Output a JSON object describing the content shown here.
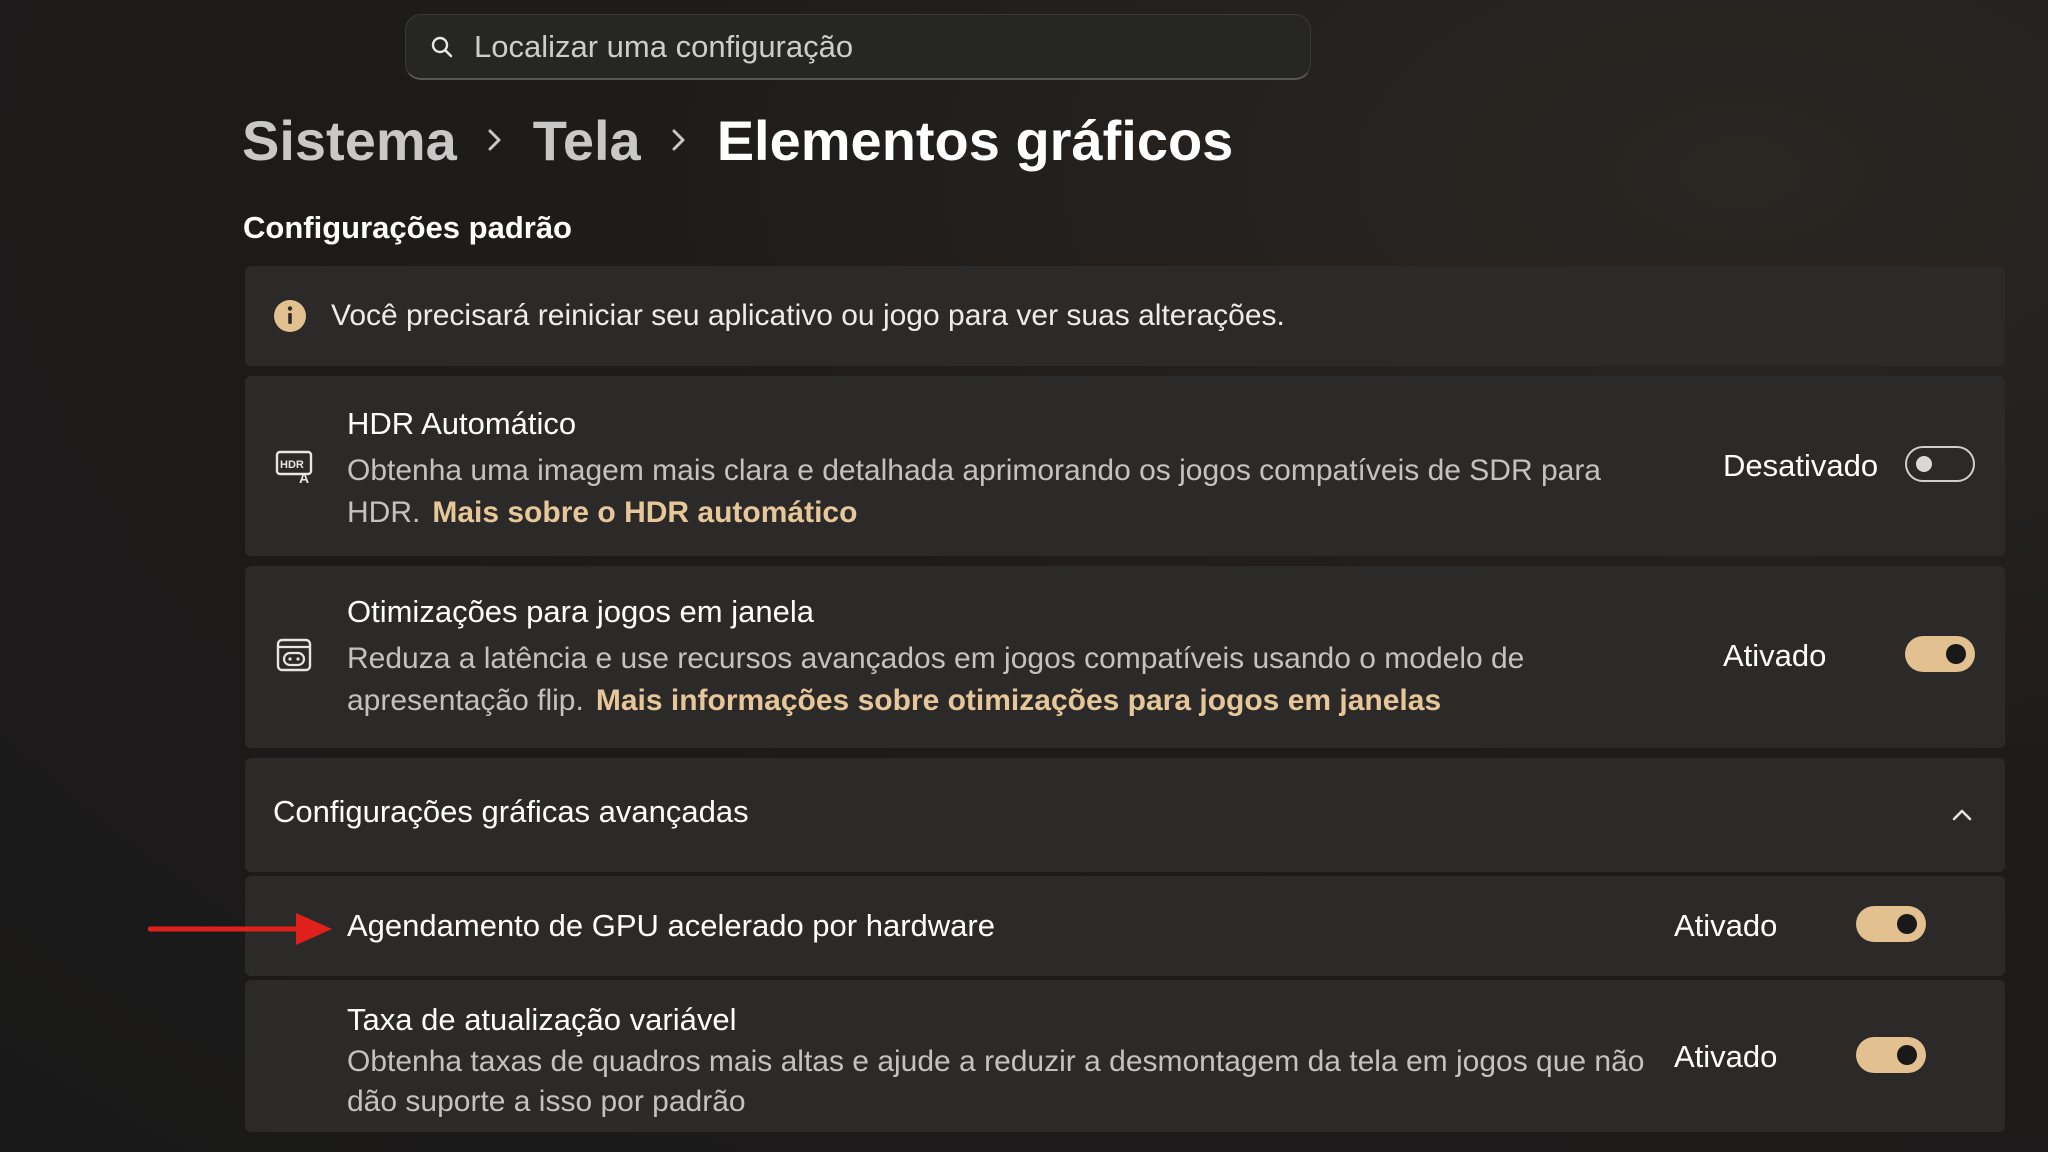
{
  "search": {
    "placeholder": "Localizar uma configuração",
    "icon": "search-icon"
  },
  "breadcrumb": {
    "items": [
      "Sistema",
      "Tela",
      "Elementos gráficos"
    ],
    "separator_icon": "chevron-right-icon"
  },
  "section": {
    "title": "Configurações padrão"
  },
  "info": {
    "icon": "info-icon",
    "text": "Você precisará reiniciar seu aplicativo ou jogo para ver suas alterações."
  },
  "settings": {
    "hdr": {
      "icon": "hdr-icon",
      "title": "HDR Automático",
      "desc_line1": "Obtenha uma imagem mais clara e detalhada aprimorando os jogos compatíveis de SDR para",
      "desc_line2": "HDR.",
      "link": "Mais sobre o HDR automático",
      "status": "Desativado",
      "enabled": false
    },
    "windowed": {
      "icon": "game-window-icon",
      "title": "Otimizações para jogos em janela",
      "desc_line1": "Reduza a latência e use recursos avançados em jogos compatíveis usando o modelo de",
      "desc_line2": "apresentação flip.",
      "link": "Mais informações sobre otimizações para jogos em janelas",
      "status": "Ativado",
      "enabled": true
    }
  },
  "advanced": {
    "title": "Configurações gráficas avançadas",
    "expanded": true,
    "chevron_icon": "chevron-up-icon",
    "items": {
      "gpu": {
        "title": "Agendamento de GPU acelerado por hardware",
        "status": "Ativado",
        "enabled": true
      },
      "vrr": {
        "title": "Taxa de atualização variável",
        "desc_line1": "Obtenha taxas de quadros mais altas e ajude a reduzir a desmontagem da tela em jogos que não",
        "desc_line2": "dão suporte a isso por padrão",
        "status": "Ativado",
        "enabled": true
      }
    }
  },
  "annotation": {
    "arrow_icon": "red-arrow-icon",
    "color": "#e0201b"
  },
  "colors": {
    "accent": "#e2c08f",
    "link": "#e7c79a",
    "card": "#2b2a29"
  }
}
